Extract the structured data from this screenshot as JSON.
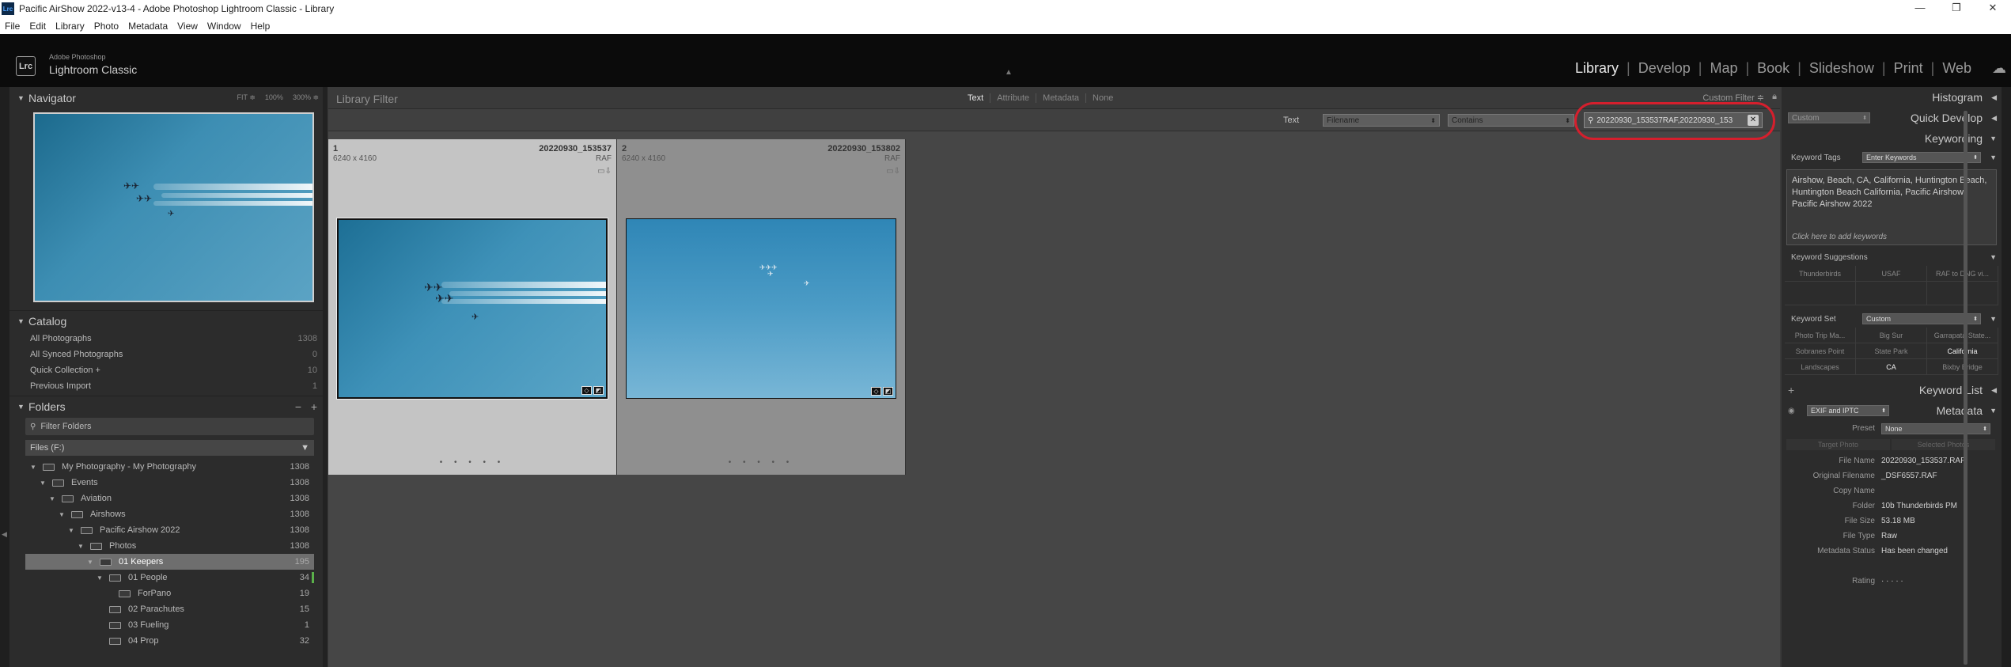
{
  "window": {
    "title": "Pacific AirShow 2022-v13-4 - Adobe Photoshop Lightroom Classic - Library",
    "icon": "Lrc",
    "controls": [
      "—",
      "❐",
      "✕"
    ]
  },
  "menu": [
    "File",
    "Edit",
    "Library",
    "Photo",
    "Metadata",
    "View",
    "Window",
    "Help"
  ],
  "identity": {
    "logo": "Lrc",
    "vendor": "Adobe Photoshop",
    "product": "Lightroom Classic"
  },
  "modules": [
    "Library",
    "Develop",
    "Map",
    "Book",
    "Slideshow",
    "Print",
    "Web"
  ],
  "module_sep": "|",
  "navigator": {
    "title": "Navigator",
    "zoom": [
      "FIT ≑",
      "100%",
      "300% ≑"
    ]
  },
  "catalog": {
    "title": "Catalog",
    "items": [
      {
        "label": "All Photographs",
        "count": "1308"
      },
      {
        "label": "All Synced Photographs",
        "count": "0"
      },
      {
        "label": "Quick Collection +",
        "count": "10"
      },
      {
        "label": "Previous Import",
        "count": "1"
      }
    ]
  },
  "folders": {
    "title": "Folders",
    "minus": "−",
    "plus": "+",
    "filter_placeholder": "Filter Folders",
    "volume": "Files (F:)",
    "items": [
      {
        "label": "My Photography - My Photography",
        "count": "1308",
        "indent": 0
      },
      {
        "label": "Events",
        "count": "1308",
        "indent": 1
      },
      {
        "label": "Aviation",
        "count": "1308",
        "indent": 2
      },
      {
        "label": "Airshows",
        "count": "1308",
        "indent": 3
      },
      {
        "label": "Pacific Airshow 2022",
        "count": "1308",
        "indent": 4
      },
      {
        "label": "Photos",
        "count": "1308",
        "indent": 5
      },
      {
        "label": "01 Keepers",
        "count": "195",
        "indent": 6
      },
      {
        "label": "01 People",
        "count": "34",
        "indent": 7
      },
      {
        "label": "ForPano",
        "count": "19",
        "indent": 8
      },
      {
        "label": "02 Parachutes",
        "count": "15",
        "indent": 7
      },
      {
        "label": "03 Fueling",
        "count": "1",
        "indent": 7
      },
      {
        "label": "04 Prop",
        "count": "32",
        "indent": 7
      }
    ]
  },
  "library_filter": {
    "label": "Library Filter",
    "tabs": [
      "Text",
      "Attribute",
      "Metadata",
      "None"
    ],
    "active": "Text",
    "preset": "Custom Filter ≑",
    "lock_icon": "lock-icon"
  },
  "text_filter": {
    "label": "Text",
    "field": "Filename",
    "rule": "Contains",
    "search_value": "20220930_153537RAF,20220930_153",
    "clear": "✕"
  },
  "grid": [
    {
      "index": "1",
      "dims": "6240 x 4160",
      "name": "20220930_153537",
      "type": "RAF",
      "selected": true
    },
    {
      "index": "2",
      "dims": "6240 x 4160",
      "name": "20220930_153802",
      "type": "RAF",
      "selected": false
    }
  ],
  "right": {
    "histogram": "Histogram",
    "quick_develop": {
      "title": "Quick Develop",
      "preset": "Custom"
    },
    "keywording": {
      "title": "Keywording",
      "tags_label": "Keyword Tags",
      "tags_mode": "Enter Keywords",
      "keywords": "Airshow, Beach, CA, California, Huntington Beach, Huntington Beach California, Pacific Airshow, Pacific Airshow 2022",
      "add_hint": "Click here to add keywords"
    },
    "suggestions": {
      "title": "Keyword Suggestions",
      "items": [
        "Thunderbirds",
        "USAF",
        "RAF to DNG vi...",
        "",
        "",
        ""
      ]
    },
    "keyword_set": {
      "title": "Keyword Set",
      "value": "Custom",
      "items": [
        "Photo Trip Ma...",
        "Big Sur",
        "Garrapata State...",
        "Sobranes Point",
        "State Park",
        "California",
        "Landscapes",
        "CA",
        "Bixby Bridge"
      ],
      "highlight": [
        "California",
        "CA"
      ]
    },
    "keyword_list": "Keyword List",
    "metadata": {
      "title": "Metadata",
      "view": "EXIF and IPTC",
      "preset_label": "Preset",
      "preset_value": "None",
      "buttons": [
        "Target Photo",
        "Selected Photos"
      ],
      "rows": [
        {
          "k": "File Name",
          "v": "20220930_153537.RAF"
        },
        {
          "k": "Original Filename",
          "v": "_DSF6557.RAF"
        },
        {
          "k": "Copy Name",
          "v": ""
        },
        {
          "k": "Folder",
          "v": "10b Thunderbirds PM"
        },
        {
          "k": "File Size",
          "v": "53.18 MB"
        },
        {
          "k": "File Type",
          "v": "Raw"
        },
        {
          "k": "Metadata Status",
          "v": "Has been changed"
        },
        {
          "k": "",
          "v": ""
        },
        {
          "k": "Rating",
          "v": "· · · · ·"
        }
      ]
    }
  }
}
